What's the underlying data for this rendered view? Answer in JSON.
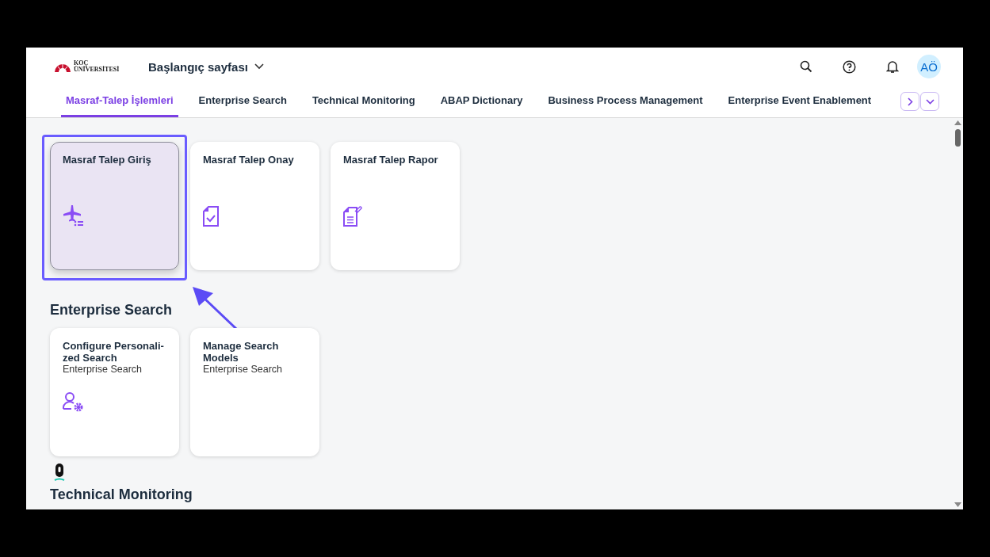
{
  "header": {
    "logo_text": [
      "KOÇ",
      "ÜNİVERSİTESİ"
    ],
    "title": "Başlangıç sayfası",
    "avatar": "AÖ"
  },
  "tabs": [
    {
      "label": "Masraf-Talep İşlemleri",
      "selected": true
    },
    {
      "label": "Enterprise Search",
      "selected": false
    },
    {
      "label": "Technical Monitoring",
      "selected": false
    },
    {
      "label": "ABAP Dictionary",
      "selected": false
    },
    {
      "label": "Business Process Management",
      "selected": false
    },
    {
      "label": "Enterprise Event Enablement",
      "selected": false
    }
  ],
  "sections": [
    {
      "tiles": [
        {
          "title": "Masraf Talep Giriş",
          "kind": "plane",
          "focused": true,
          "highlighted": true
        },
        {
          "title": "Masraf Talep Onay",
          "kind": "doc-check",
          "focused": false,
          "highlighted": false
        },
        {
          "title": "Masraf Talep Rapor",
          "kind": "doc-edit",
          "focused": false,
          "highlighted": false
        }
      ]
    },
    {
      "title": "Enterprise Search",
      "tiles": [
        {
          "title": "Configure Personali-zed Search",
          "subtitle": "Enterprise Search",
          "kind": "user-gear",
          "focused": false,
          "highlighted": false
        },
        {
          "title": "Manage Search Models",
          "subtitle": "Enterprise Search",
          "focused": false,
          "highlighted": false
        }
      ]
    },
    {
      "title": "Technical Monitoring"
    }
  ]
}
